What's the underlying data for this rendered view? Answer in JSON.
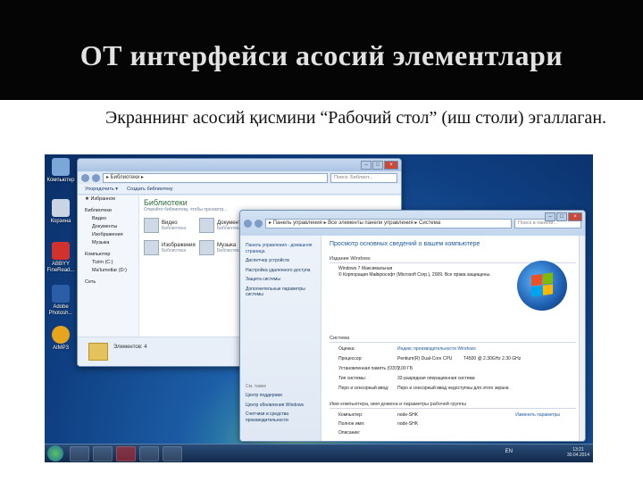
{
  "slide": {
    "title": "ОТ интерфейси асосий элементлари",
    "text": "Экраннинг асосий қисмини “Рабочий стол” (иш столи) эгаллаган."
  },
  "desktop": {
    "icons": [
      {
        "label": "Компьютер",
        "icon": "computer-icon",
        "color": "#7aa6d8"
      },
      {
        "label": "Корзина",
        "icon": "recycle-bin-icon",
        "color": "#c9d5e3"
      },
      {
        "label": "ABBYY FineRead...",
        "icon": "abbyy-icon",
        "color": "#d2322d"
      },
      {
        "label": "Adobe Photosh...",
        "icon": "photoshop-icon",
        "color": "#2c5ea8"
      },
      {
        "label": "AIMP3",
        "icon": "aimp-icon",
        "color": "#e7a51c"
      }
    ],
    "libraries_window": {
      "address": "▸ Библиотеки ▸",
      "search_placeholder": "Поиск: Библиот...",
      "toolbar": [
        "Упорядочить ▾",
        "Создать библиотеку"
      ],
      "nav": [
        {
          "label": "★ Избранное",
          "indent": false,
          "gap": false
        },
        {
          "label": "Библиотеки",
          "indent": false,
          "gap": true
        },
        {
          "label": "Видео",
          "indent": true,
          "gap": false
        },
        {
          "label": "Документы",
          "indent": true,
          "gap": false
        },
        {
          "label": "Изображения",
          "indent": true,
          "gap": false
        },
        {
          "label": "Музыка",
          "indent": true,
          "gap": false
        },
        {
          "label": "Компьютер",
          "indent": false,
          "gap": true
        },
        {
          "label": "Tizim (C:)",
          "indent": true,
          "gap": false
        },
        {
          "label": "Ma'lumotlar (D:)",
          "indent": true,
          "gap": false
        },
        {
          "label": "Сеть",
          "indent": false,
          "gap": true
        }
      ],
      "title": "Библиотеки",
      "subtitle": "Откройте библиотеку, чтобы просмотр...",
      "items": [
        {
          "name": "Видео",
          "type": "Библиотека"
        },
        {
          "name": "Документы",
          "type": "Библиотека"
        },
        {
          "name": "Изображения",
          "type": "Библиотека"
        },
        {
          "name": "Музыка",
          "type": "Библиотека"
        }
      ],
      "status": "Элементов: 4"
    },
    "system_window": {
      "address": "▸ Панель управления ▸ Все элементы панели управления ▸ Система",
      "search_placeholder": "Поиск в панели...",
      "side_links": [
        "Панель управления - домашняя страница",
        "Диспетчер устройств",
        "Настройка удаленного доступа",
        "Защита системы",
        "Дополнительные параметры системы"
      ],
      "see_also": "См. также",
      "see_also_links": [
        "Центр поддержки",
        "Центр обновления Windows",
        "Счетчики и средства производительности"
      ],
      "heading": "Просмотр основных сведений о вашем компьютере",
      "edition_section": "Издание Windows",
      "edition": "Windows 7 Максимальная",
      "copyright": "© Корпорация Майкрософт (Microsoft Corp.), 2009. Все права защищены.",
      "system_section": "Система",
      "rows": [
        {
          "k": "Оценка:",
          "v": "Индекс производительности Windows",
          "v2": ""
        },
        {
          "k": "Процессор:",
          "v": "Pentium(R) Dual-Core CPU",
          "v2": "T4500 @ 2.30GHz  2.30 GHz"
        },
        {
          "k": "Установленная память (ОЗУ):",
          "v": "2,00 ГБ",
          "v2": ""
        },
        {
          "k": "Тип системы:",
          "v": "32-разрядная операционная система",
          "v2": ""
        },
        {
          "k": "Перо и сенсорный ввод:",
          "v": "Перо и сенсорный ввод недоступны для этого экрана",
          "v2": ""
        }
      ],
      "computer_section": "Имя компьютера, имя домена и параметры рабочей группы",
      "computer_rows": [
        {
          "k": "Компьютер:",
          "v": "node-SHK"
        },
        {
          "k": "Полное имя:",
          "v": "node-SHK"
        },
        {
          "k": "Описание:",
          "v": ""
        }
      ],
      "change_settings": "Изменить параметры"
    },
    "taskbar": {
      "lang": "EN",
      "time": "13:21",
      "date": "30.04.2014"
    }
  }
}
